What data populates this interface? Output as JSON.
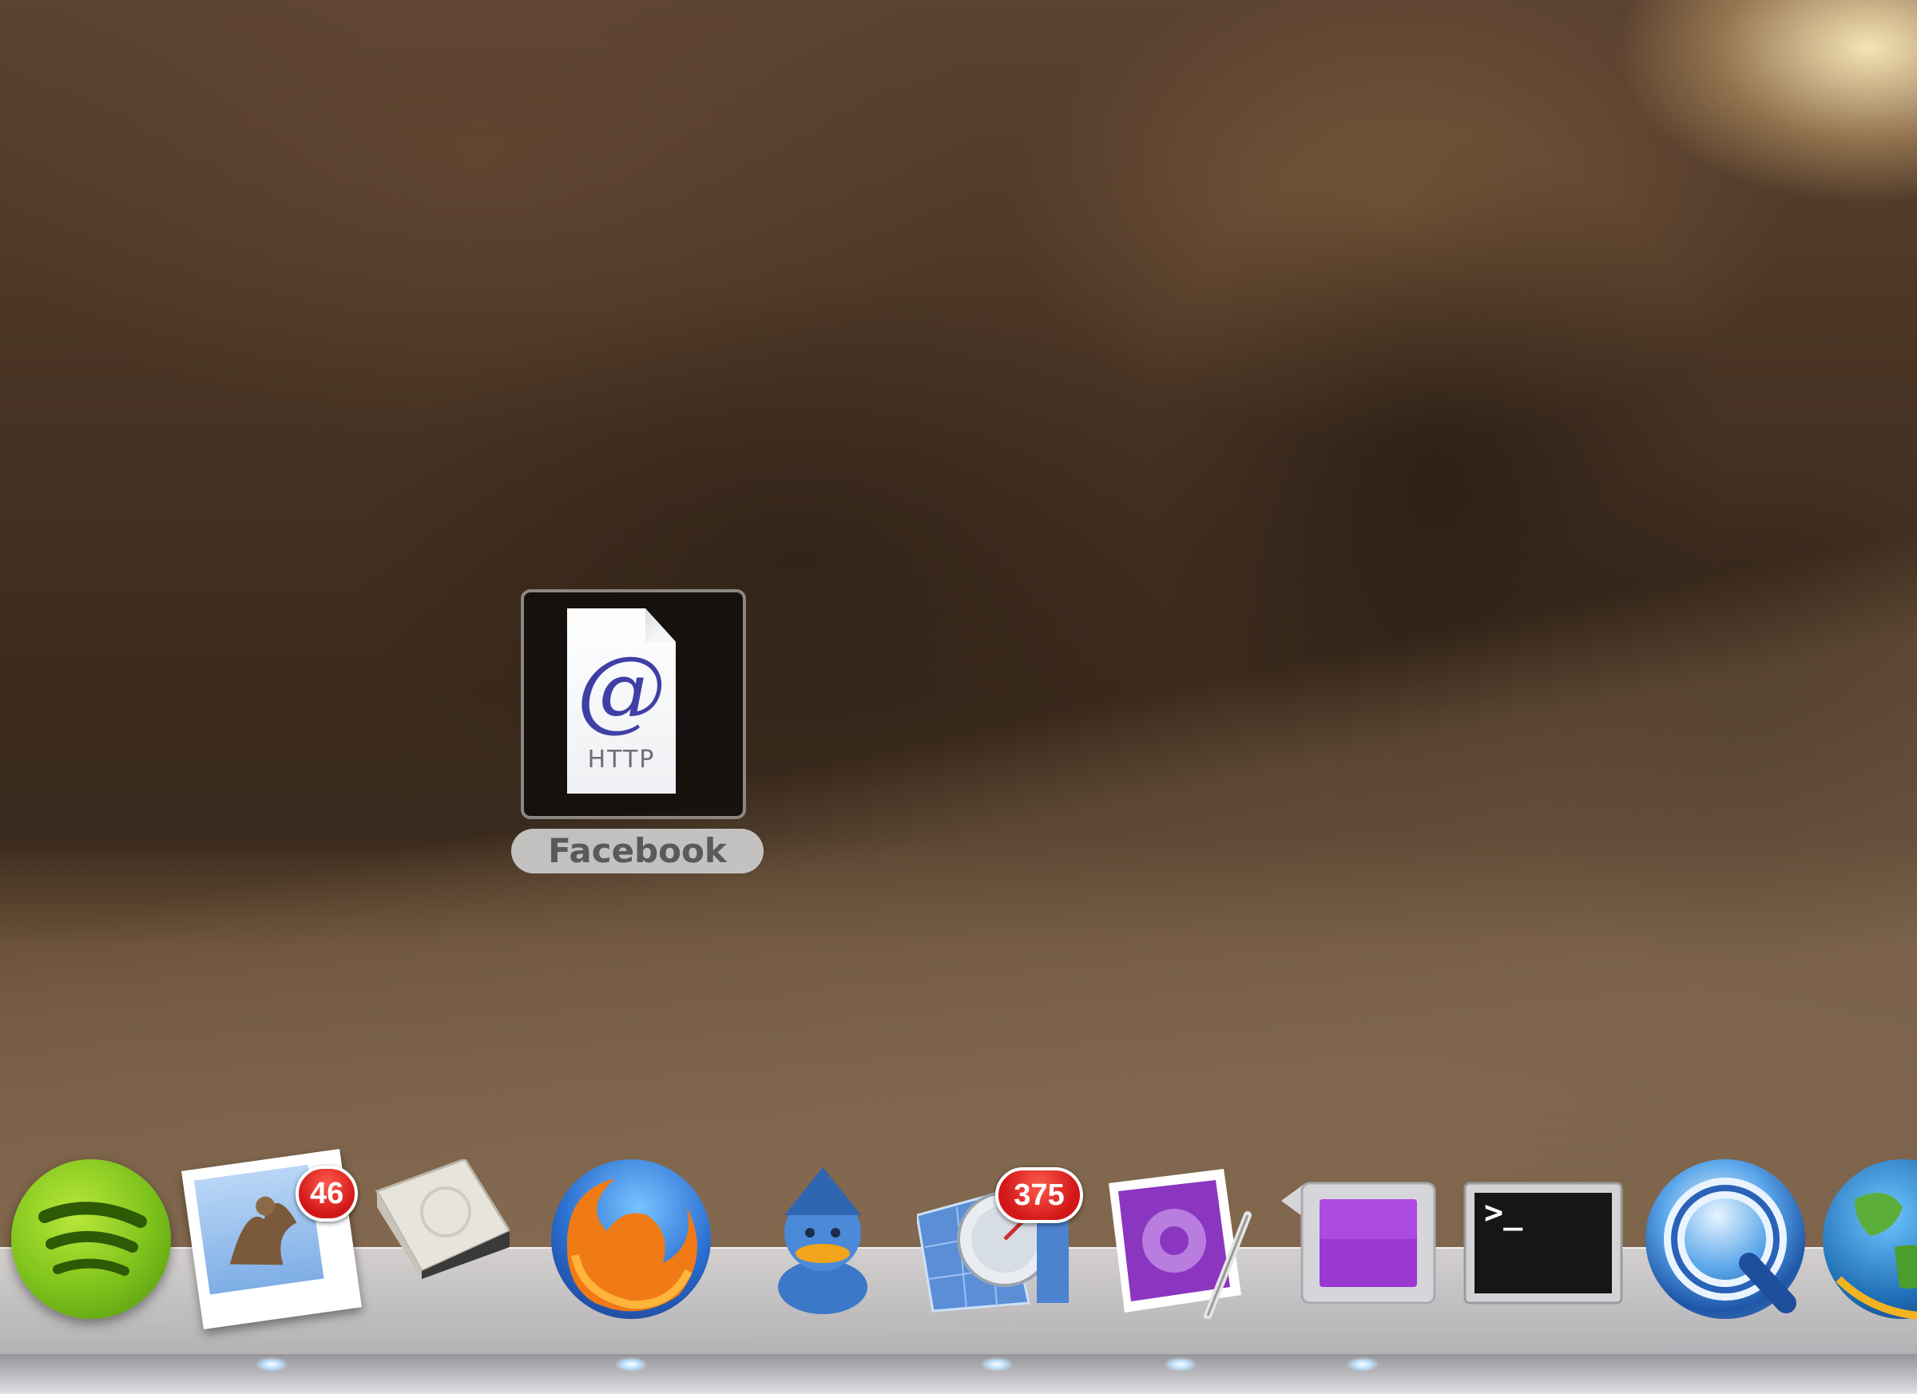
{
  "desktop": {
    "file": {
      "name": "Facebook",
      "icon": "http-location-file-icon",
      "icon_glyph": "@",
      "icon_type_label": "HTTP"
    }
  },
  "dock": {
    "items": [
      {
        "name": "Spotify",
        "icon": "spotify-icon",
        "running": false
      },
      {
        "name": "Mail",
        "icon": "mail-stamp-icon",
        "badge": "46",
        "running": true
      },
      {
        "name": "Disk Utility",
        "icon": "hard-drive-icon",
        "running": false
      },
      {
        "name": "Firefox",
        "icon": "firefox-icon",
        "running": true
      },
      {
        "name": "Adium",
        "icon": "duck-icon",
        "running": false
      },
      {
        "name": "Coda",
        "icon": "coda-icon",
        "badge": "375",
        "running": true
      },
      {
        "name": "Xcode",
        "icon": "purple-gear-pen-icon",
        "running": true
      },
      {
        "name": "App",
        "icon": "purple-square-icon",
        "running": true
      },
      {
        "name": "Terminal",
        "icon": "terminal-icon",
        "terminal_prompt": ">_",
        "running": false
      },
      {
        "name": "QuickTime Player",
        "icon": "quicktime-icon",
        "running": false
      },
      {
        "name": "Globe",
        "icon": "globe-icon",
        "running": false
      }
    ]
  },
  "colors": {
    "badge": "#d01616",
    "terminal_text": "#ffffff",
    "xcode_purple": "#8b36c0"
  }
}
